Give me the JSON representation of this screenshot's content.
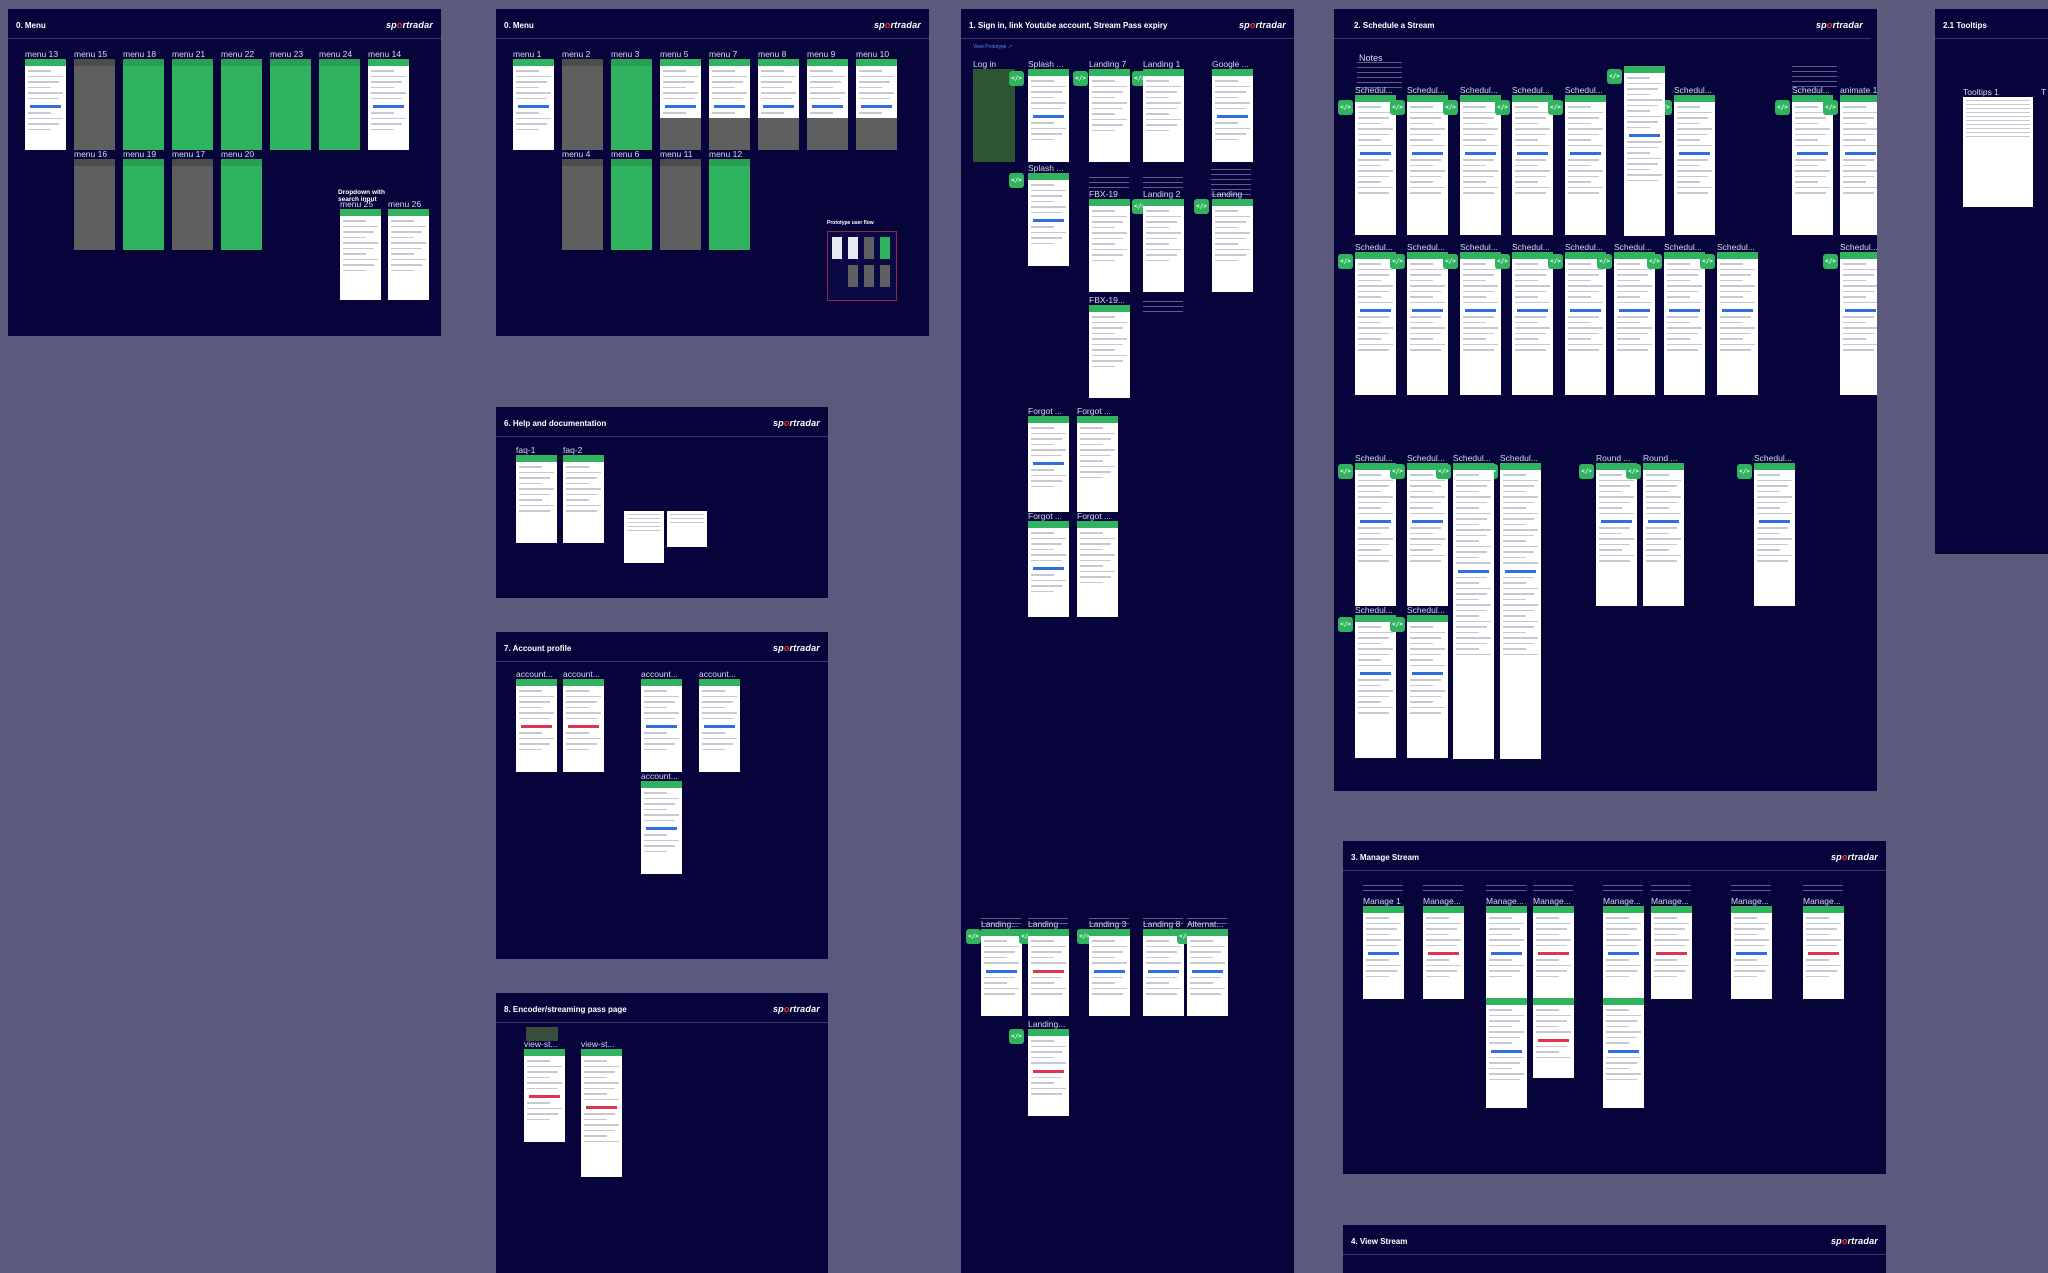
{
  "brand": {
    "prefix": "sp",
    "o": "o",
    "suffix": "rtradar"
  },
  "frames": {
    "menu_a": {
      "title": "0. Menu"
    },
    "menu_b": {
      "title": "0. Menu",
      "prototype_label": "Prototype user flow"
    },
    "signin": {
      "title": "1. Sign in, link Youtube account, Stream Pass expiry",
      "prototype_link": "View Prototype ↗"
    },
    "schedule": {
      "title": "2. Schedule a Stream",
      "notes_label": "Notes"
    },
    "tooltips": {
      "title": "2.1 Tooltips"
    },
    "help": {
      "title": "6. Help and documentation"
    },
    "account": {
      "title": "7. Account profile"
    },
    "encoder": {
      "title": "8. Encoder/streaming pass page"
    },
    "manage": {
      "title": "3. Manage Stream"
    },
    "view": {
      "title": "4. View Stream"
    }
  },
  "menu_a_screens": {
    "row1": [
      "menu 13",
      "menu 15",
      "menu 18",
      "menu 21",
      "menu 22",
      "menu 23",
      "menu 24",
      "menu 14"
    ],
    "row2": [
      "menu 16",
      "menu 19",
      "menu 17",
      "menu 20"
    ],
    "dropdown_label": "Dropdown with search input",
    "extra": [
      "menu 25",
      "menu 26"
    ]
  },
  "menu_b_screens": {
    "row1": [
      "menu 1",
      "menu 2",
      "menu 3",
      "menu 5",
      "menu 7",
      "menu 8",
      "menu 9",
      "menu 10"
    ],
    "row2": [
      "menu 4",
      "menu 6",
      "menu 11",
      "menu 12"
    ]
  },
  "signin_screens": {
    "top": [
      "Log in",
      "Splash ...",
      "Landing 7",
      "Landing 1",
      "Google ..."
    ],
    "mid": [
      "Splash ...",
      "FBX-19",
      "Landing 2",
      "Landing"
    ],
    "mid2": [
      "FBX-19..."
    ],
    "forgot": [
      "Forgot ...",
      "Forgot ...",
      "Forgot ...",
      "Forgot ..."
    ],
    "bottom": [
      "Landing...",
      "Landing",
      "Landing 3",
      "Landing 8",
      "Alternat..."
    ],
    "bottom2": [
      "Landing..."
    ]
  },
  "schedule_screens": {
    "row1": [
      "Schedul...",
      "Schedul...",
      "Schedul...",
      "Schedul...",
      "Schedul...",
      "Schedul...",
      "Schedul...",
      "animate 1"
    ],
    "row2": [
      "Schedul...",
      "Schedul...",
      "Schedul...",
      "Schedul...",
      "Schedul...",
      "Schedul...",
      "Schedul...",
      "Schedul...",
      "Schedul..."
    ],
    "row3": [
      "Schedul...",
      "Schedul...",
      "Schedul...",
      "Schedul...",
      "Round ...",
      "Round ...",
      "Schedul..."
    ],
    "row4": [
      "Schedul...",
      "Schedul..."
    ]
  },
  "tooltips_screens": [
    "Tooltips 1",
    "T"
  ],
  "help_screens": [
    "faq-1",
    "faq-2"
  ],
  "account_screens": [
    "account...",
    "account...",
    "account...",
    "account...",
    "account..."
  ],
  "encoder_screens": [
    "view-st...",
    "view-st..."
  ],
  "manage_screens": [
    "Manage 1",
    "Manage...",
    "Manage...",
    "Manage...",
    "Manage...",
    "Manage...",
    "Manage...",
    "Manage..."
  ],
  "code_glyph": "</>"
}
